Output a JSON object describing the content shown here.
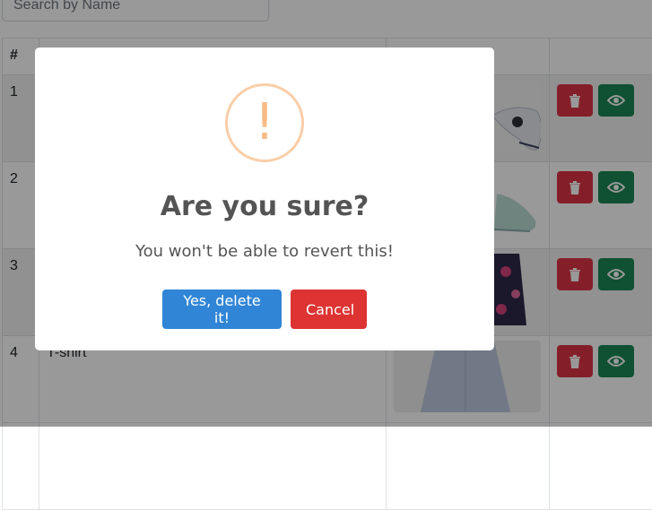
{
  "search": {
    "placeholder": "Search by Name"
  },
  "table": {
    "headers": [
      "#",
      "",
      "",
      ""
    ],
    "rows": [
      {
        "index": "1",
        "name": "",
        "image_icon": "gamepad-image"
      },
      {
        "index": "2",
        "name": "",
        "image_icon": "shoe-image"
      },
      {
        "index": "3",
        "name": "",
        "image_icon": "floral-shirt-image"
      },
      {
        "index": "4",
        "name": "T-shirt",
        "image_icon": "dress-image"
      }
    ],
    "delete_icon": "trash-icon",
    "view_icon": "eye-icon"
  },
  "dialog": {
    "icon": "!",
    "title": "Are you sure?",
    "text": "You won't be able to revert this!",
    "confirm_label": "Yes, delete it!",
    "cancel_label": "Cancel"
  },
  "colors": {
    "delete": "#dc3545",
    "view": "#198754",
    "confirm": "#3085d6",
    "cancel": "#dd3333",
    "warning": "#f8bb86"
  }
}
